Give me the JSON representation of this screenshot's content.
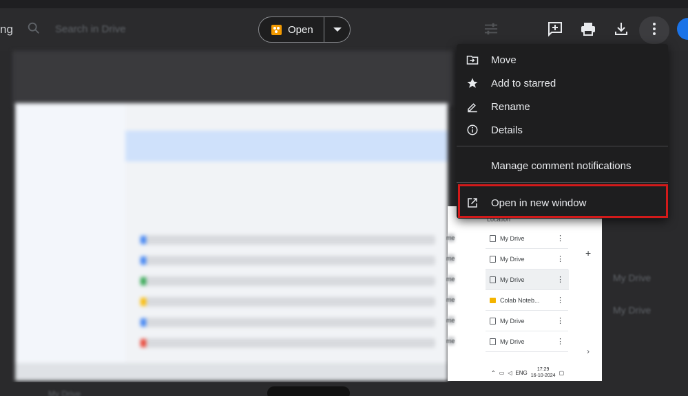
{
  "app": {
    "brand_fragment": "ng",
    "search_placeholder": "Search in Drive"
  },
  "toolbar": {
    "open_label": "Open"
  },
  "context_menu": {
    "items": [
      {
        "label": "Move",
        "icon": "move-to-folder-icon"
      },
      {
        "label": "Add to starred",
        "icon": "star-icon"
      },
      {
        "label": "Rename",
        "icon": "pencil-icon"
      },
      {
        "label": "Details",
        "icon": "info-icon"
      },
      {
        "label": "Manage comment notifications",
        "icon": ""
      },
      {
        "label": "Open in new window",
        "icon": "open-external-icon"
      }
    ],
    "highlight_color": "#d21a1a"
  },
  "preview_list": {
    "column_header": "Location",
    "owner_fragment": "me",
    "rows": [
      {
        "location": "My Drive",
        "type": "drive"
      },
      {
        "location": "My Drive",
        "type": "drive"
      },
      {
        "location": "My Drive",
        "type": "drive",
        "selected": true
      },
      {
        "location": "Colab Noteb...",
        "type": "folder"
      },
      {
        "location": "My Drive",
        "type": "drive"
      },
      {
        "location": "My Drive",
        "type": "drive"
      }
    ]
  },
  "background_labels": {
    "right_1": "My Drive",
    "right_2": "My Drive",
    "bottom_left": "My Drive"
  },
  "taskbar": {
    "language": "ENG",
    "time": "17:29",
    "date": "16-10-2024"
  }
}
